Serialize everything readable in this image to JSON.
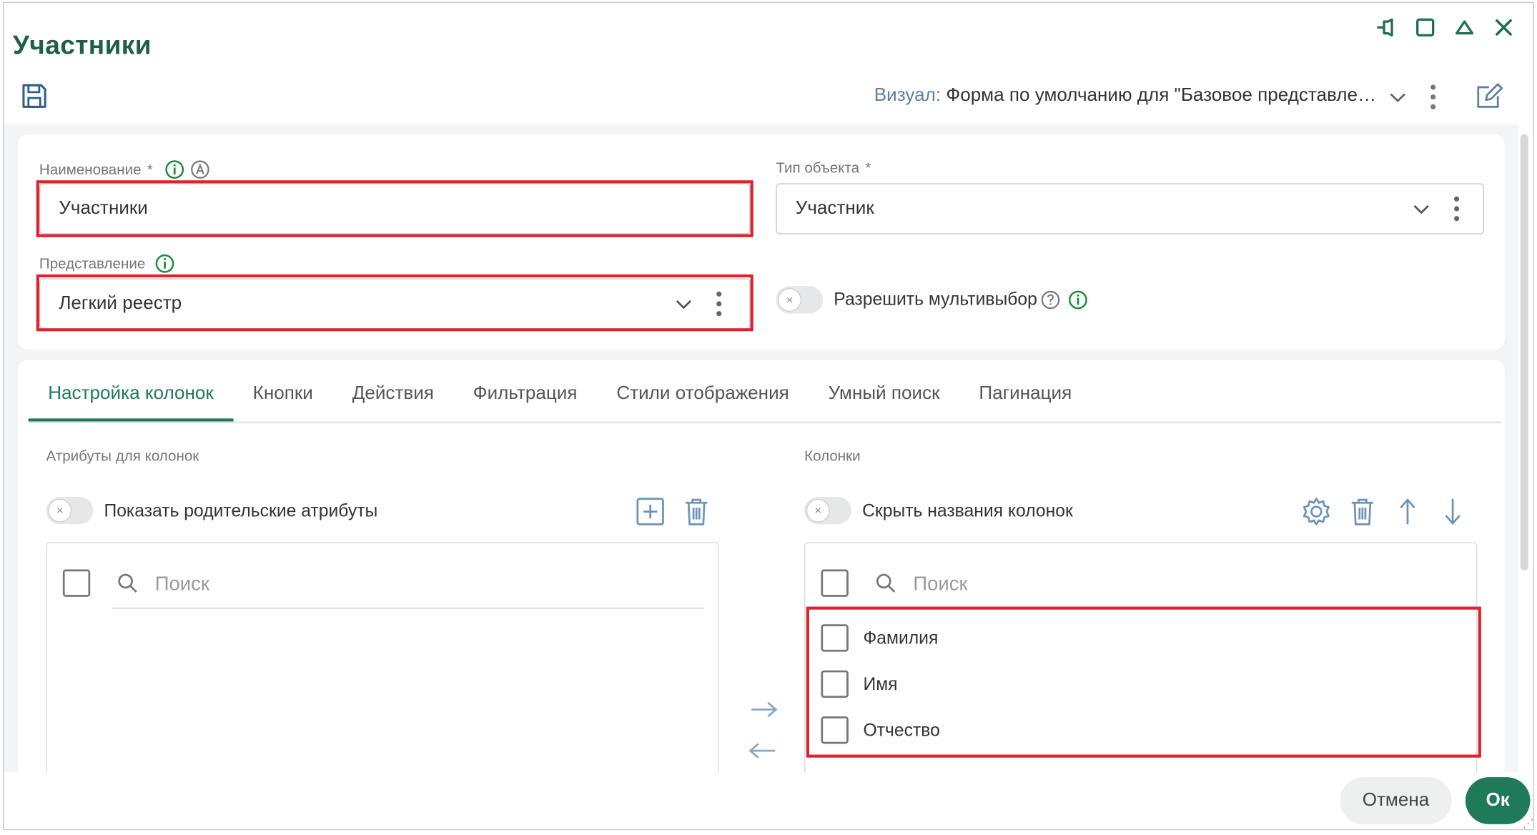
{
  "window": {
    "title": "Участники",
    "controls": [
      "pin-icon",
      "maximize-icon",
      "collapse-icon",
      "close-icon"
    ]
  },
  "toolbar": {
    "visual_label": "Визуал:",
    "visual_value": "Форма по умолчанию для \"Базовое представле…"
  },
  "form": {
    "name_label": "Наименование",
    "name_required": "*",
    "name_value": "Участники",
    "object_type_label": "Тип объекта",
    "object_type_required": "*",
    "object_type_value": "Участник",
    "view_label": "Представление",
    "view_value": "Легкий реестр",
    "multiselect_label": "Разрешить мультивыбор"
  },
  "tabs": [
    {
      "label": "Настройка колонок",
      "active": true
    },
    {
      "label": "Кнопки"
    },
    {
      "label": "Действия"
    },
    {
      "label": "Фильтрация"
    },
    {
      "label": "Стили отображения"
    },
    {
      "label": "Умный поиск"
    },
    {
      "label": "Пагинация"
    }
  ],
  "attributes": {
    "section_label": "Атрибуты для колонок",
    "toggle_label": "Показать родительские атрибуты",
    "search_placeholder": "Поиск"
  },
  "columns": {
    "section_label": "Колонки",
    "toggle_label": "Скрыть названия колонок",
    "search_placeholder": "Поиск",
    "items": [
      "Фамилия",
      "Имя",
      "Отчество"
    ]
  },
  "footer": {
    "cancel_label": "Отмена",
    "ok_label": "Ок"
  },
  "colors": {
    "accent": "#1f7a5a",
    "title": "#1e5e4a",
    "highlight": "#e0202c",
    "label_link": "#5b7fa6"
  }
}
